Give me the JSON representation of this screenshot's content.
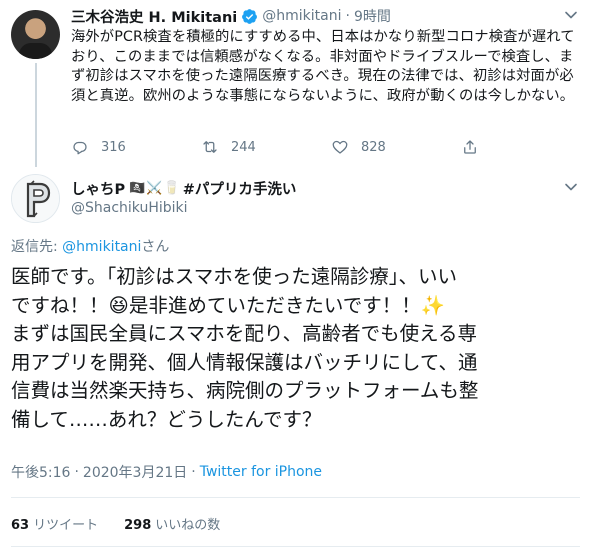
{
  "parent_tweet": {
    "name": "三木谷浩史 H. Mikitani",
    "handle": "@hmikitani",
    "separator": "·",
    "time": "9時間",
    "text": "海外がPCR検査を積極的にすすめる中、日本はかなり新型コロナ検査が遅れており、このままでは信頼感がなくなる。非対面やドライブスルーで検査し、まず初診はスマホを使った遠隔医療するべき。現在の法律では、初診は対面が必須と真逆。欧州のような事態にならないように、政府が動くのは今しかない。",
    "replies": "316",
    "retweets": "244",
    "likes": "828"
  },
  "reply_tweet": {
    "name": "しゃちP",
    "name_emoji": "🏴‍☠️⚔️🥛",
    "name_suffix": "#パプリカ手洗い",
    "handle": "@ShachikuHibiki",
    "reply_prefix": "返信先: ",
    "reply_to": "@hmikitani",
    "reply_suffix": "さん",
    "lines": [
      "医師です。「初診はスマホを使った遠隔診療」、いい",
      "ですね！！😆是非進めていただきたいです！！✨",
      "まずは国民全員にスマホを配り、高齢者でも使える専",
      "用アプリを開発、個人情報保護はバッチリにして、通",
      "信費は当然楽天持ち、病院側のプラットフォームも整",
      "備して……あれ？どうしたんです？"
    ],
    "time": "午後5:16",
    "date": "2020年3月21日",
    "meta_sep": "·",
    "source": "Twitter for iPhone",
    "retweet_count": "63",
    "retweet_label": "リツイート",
    "like_count": "298",
    "like_label": "いいねの数"
  },
  "icons": {
    "verified": "verified-badge-icon",
    "chevron": "chevron-down-icon",
    "reply": "reply-icon",
    "retweet": "retweet-icon",
    "like": "heart-icon",
    "share": "share-icon"
  },
  "colors": {
    "text": "#14171a",
    "secondary": "#657786",
    "link": "#1b95e0",
    "divider": "#e6ecf0"
  }
}
